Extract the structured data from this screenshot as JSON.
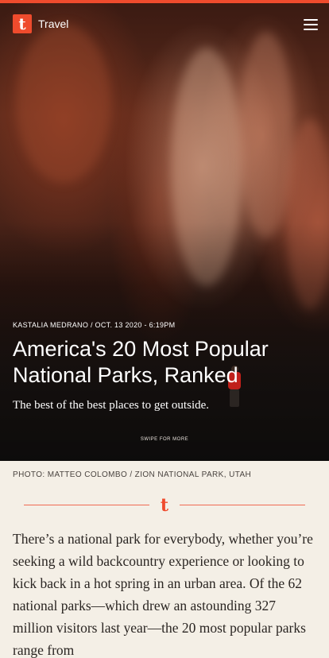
{
  "header": {
    "logo_glyph": "t",
    "section": "Travel",
    "menu_icon": "hamburger-menu-icon",
    "accent_color": "#ef4b2d"
  },
  "article": {
    "byline": "KASTALIA MEDRANO / OCT. 13 2020 - 6:19PM",
    "title": "America's 20 Most Popular National Parks, Ranked",
    "dek": "The best of the best places to get outside.",
    "swipe_hint": "SWIPE FOR MORE",
    "photo_credit": "PHOTO: MATTEO COLOMBO / ZION NATIONAL PARK, UTAH",
    "divider_glyph": "t",
    "body": "There’s a national park for everybody, whether you’re seeking a wild backcountry experience or looking to kick back in a hot spring in an urban area. Of the 62 national parks—which drew an astounding 327 million visitors last year—the 20 most popular parks range from"
  }
}
